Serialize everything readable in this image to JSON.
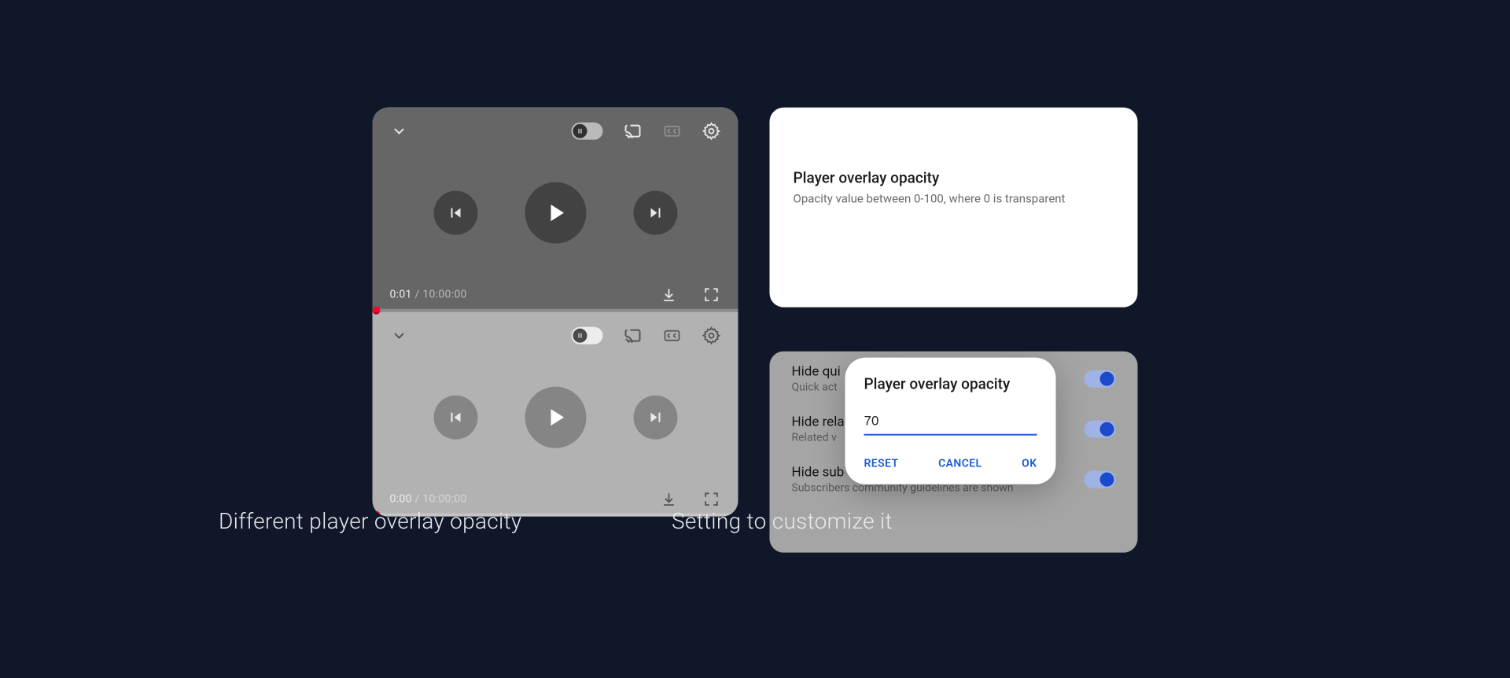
{
  "players": [
    {
      "time_current": "0:01",
      "time_total": "10:00:00"
    },
    {
      "time_current": "0:00",
      "time_total": "10:00:00"
    }
  ],
  "setting_card": {
    "title": "Player overlay opacity",
    "subtitle": "Opacity value between 0-100, where 0 is transparent"
  },
  "settings_rows": [
    {
      "title": "Hide qui",
      "subtitle": "Quick act"
    },
    {
      "title": "Hide rela",
      "subtitle": "Related v"
    },
    {
      "title": "Hide sub",
      "subtitle": "Subscribers community guidelines are shown"
    }
  ],
  "dialog": {
    "title": "Player overlay opacity",
    "value": "70",
    "reset": "RESET",
    "cancel": "CANCEL",
    "ok": "OK"
  },
  "captions": {
    "left": "Different player overlay opacity",
    "right": "Setting  to customize it"
  },
  "sep": " / ",
  "icons": {
    "chevron_down": "chevron-down",
    "pause": "pause",
    "cast": "cast",
    "cc": "closed-captions",
    "gear": "settings",
    "prev": "skip-previous",
    "play": "play",
    "next": "skip-next",
    "download": "download",
    "fullscreen": "fullscreen"
  }
}
